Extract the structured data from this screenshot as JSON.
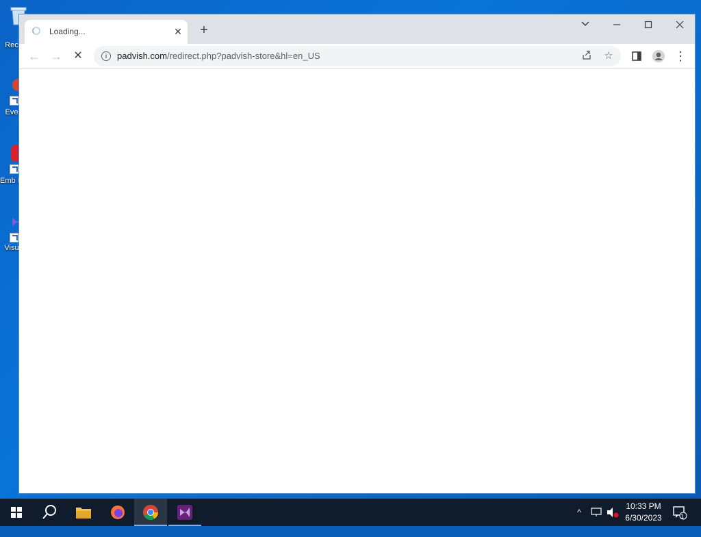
{
  "desktop": {
    "icons": [
      {
        "label": "Rec",
        "icon": "recycle-bin-icon"
      },
      {
        "label": "Eve",
        "icon": "event-viewer-icon"
      },
      {
        "label": "Emb De",
        "icon": "app-shortcut-icon"
      },
      {
        "label": "Visu",
        "icon": "visual-studio-icon"
      }
    ]
  },
  "browser": {
    "tab": {
      "title": "Loading...",
      "close_symbol": "✕"
    },
    "new_tab_symbol": "+",
    "window_controls": {
      "tab_search": "⌄",
      "minimize": "—",
      "maximize": "☐",
      "close": "✕"
    },
    "toolbar": {
      "back": "←",
      "forward": "→",
      "stop": "✕",
      "url_host": "padvish.com",
      "url_path": "/redirect.php?padvish-store&hl=en_US",
      "share": "⇪",
      "bookmark": "☆",
      "side_panel": "▯",
      "menu": "⋮"
    }
  },
  "taskbar": {
    "apps": [
      "start-icon",
      "search-icon",
      "file-explorer-icon",
      "firefox-icon",
      "chrome-icon",
      "visual-studio-icon"
    ],
    "tray": {
      "chevron": "^",
      "time": "10:33 PM",
      "date": "6/30/2023",
      "notification_count": "1"
    }
  },
  "colors": {
    "desktop_bg": "#0a6bcf",
    "tabstrip_bg": "#dee1e6",
    "taskbar_bg": "#101c2b"
  }
}
